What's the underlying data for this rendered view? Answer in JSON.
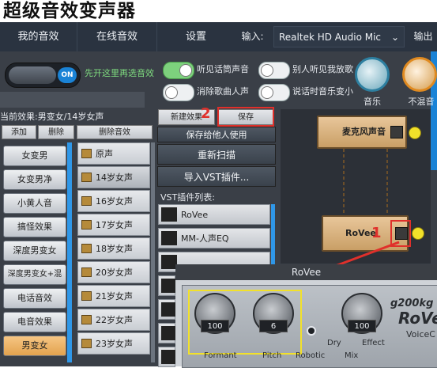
{
  "app": {
    "title": "超级音效变声器"
  },
  "nav": {
    "tabs": [
      "我的音效",
      "在线音效",
      "设置"
    ],
    "input_label": "输入:",
    "input_value": "Realtek HD Audio Mic input",
    "output_label": "输出"
  },
  "controls": {
    "power_toggle": {
      "label": "ON",
      "state": "on"
    },
    "preset_hint": "先开这里再选音效",
    "toggles": [
      {
        "label": "听见话筒声音",
        "state": "on"
      },
      {
        "label": "别人听见我放歌",
        "state": "off"
      },
      {
        "label": "消除歌曲人声",
        "state": "off"
      },
      {
        "label": "说话时音乐变小",
        "state": "off"
      }
    ],
    "dials": [
      {
        "label": "音乐"
      },
      {
        "label": "不混音"
      }
    ]
  },
  "effects": {
    "current_label": "当前效果:男变女/14岁女声",
    "actions": [
      "添加",
      "删除",
      "删除音效"
    ],
    "categories": [
      "女变男",
      "女变男净",
      "小黄人音",
      "搞怪效果",
      "深度男变女",
      "深度男变女+混响",
      "电话音效",
      "电音效果",
      "男变女"
    ],
    "selected_category": "男变女",
    "presets": [
      "原声",
      "14岁女声",
      "16岁女声",
      "17岁女声",
      "18岁女声",
      "20岁女声",
      "21岁女声",
      "22岁女声",
      "23岁女声"
    ],
    "selected_preset": "14岁女声"
  },
  "middle": {
    "new_effect": "新建效果",
    "save": "保存",
    "save_for_others": "保存给他人使用",
    "rescan": "重新扫描",
    "import_vst": "导入VST插件...",
    "vst_list_label": "VST插件列表:",
    "vst_items": [
      "RoVee",
      "MM-人声EQ"
    ]
  },
  "graph": {
    "nodes": [
      {
        "label": "麦克风声音"
      },
      {
        "label": "RoVee"
      }
    ]
  },
  "annotations": {
    "marker_1": "1",
    "marker_2": "2"
  },
  "plugin": {
    "title": "RoVee",
    "brand": "g200kg",
    "name": "RoVe",
    "sub": "VoiceC",
    "formant_value": "100",
    "pitch_value": "6",
    "mix_value": "100",
    "labels": {
      "formant": "Formant",
      "pitch": "Pitch",
      "robotic": "Robotic",
      "dry": "Dry",
      "effect": "Effect",
      "mix": "Mix"
    }
  },
  "colors": {
    "accent": "#1a83d6",
    "toggle_on": "#7dd17d",
    "annotation_red": "#e0302b",
    "highlight_yellow": "#f2e12a"
  }
}
